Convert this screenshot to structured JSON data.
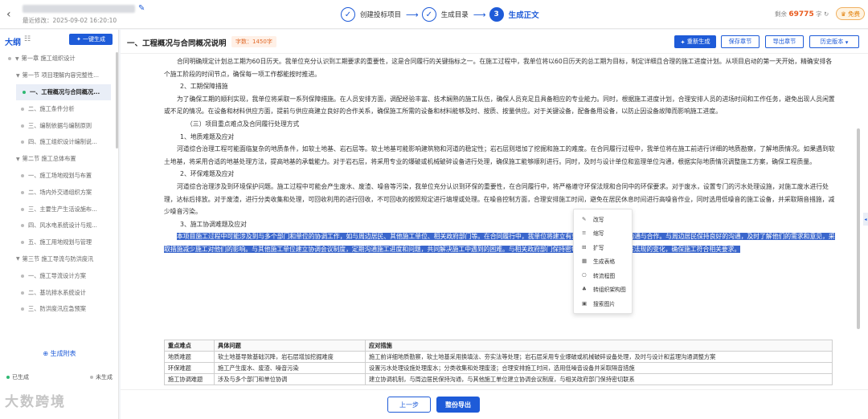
{
  "header": {
    "last_modified": "最近修改：2025-09-02 16:20:10",
    "steps": [
      {
        "icon": "✓",
        "label": "创建投标项目"
      },
      {
        "icon": "✓",
        "label": "生成目录"
      },
      {
        "icon": "3",
        "label": "生成正文"
      }
    ],
    "remain_label": "剩余",
    "remain_value": "69775",
    "remain_unit": "字",
    "vip_label": "免费"
  },
  "sidebar": {
    "title": "大纲",
    "generate_all": "一键生成",
    "items": [
      {
        "label": "第一章 施工组织设计"
      },
      {
        "label": "第一节 项目理解内容完整性..."
      },
      {
        "label": "一、工程概况与合同概况..."
      },
      {
        "label": "二、施工条件分析"
      },
      {
        "label": "三、编制依据与编制原则"
      },
      {
        "label": "四、施工组织设计编制说..."
      },
      {
        "label": "第二节 施工总体布置"
      },
      {
        "label": "一、施工场地规划与布置"
      },
      {
        "label": "二、场内外交通组织方案"
      },
      {
        "label": "三、主要生产生活设施布..."
      },
      {
        "label": "四、风水电系统设计与规..."
      },
      {
        "label": "五、施工用地规划与管理"
      },
      {
        "label": "第三节 施工导流与防洪度汛"
      },
      {
        "label": "一、施工导流设计方案"
      },
      {
        "label": "二、基坑排水系统设计"
      },
      {
        "label": "三、防洪度汛应急预案"
      }
    ],
    "attach": "生成附表",
    "legend_done": "已生成",
    "legend_todo": "未生成"
  },
  "main": {
    "section_title": "一、工程概况与合同概况说明",
    "word_count": "字数：1450字",
    "buttons": {
      "regen": "重新生成",
      "save": "保存章节",
      "export_section": "导出章节",
      "history": "历史版本"
    },
    "paragraphs": [
      "合同明确规定计划总工期为60日历天。我单位充分认识到工期要求的重要性，这是合同履行的关键指标之一。在施工过程中，我单位将以60日历天的总工期为目标，制定详细且合理的施工进度计划。从项目启动的第一天开始，精确安排各个施工阶段的时间节点，确保每一项工作都能按时推进。",
      "2、工期保障措施",
      "为了确保工期的顺利实现，我单位将采取一系列保障措施。在人员安排方面，调配经验丰富、技术娴熟的施工队伍，确保人员充足且具备相应的专业能力。同时，根据施工进度计划，合理安排人员的进场时间和工作任务，避免出现人员闲置或不足的情况。在设备和材料供应方面，提前与供应商建立良好的合作关系，确保施工所需的设备和材料能够及时、按质、按量供应。对于关键设备，配备备用设备，以防止因设备故障而影响施工进度。",
      "（三）项目重点难点及合同履行处理方式",
      "1、地质难题及应对",
      "河道综合治理工程可能面临复杂的地质条件，如软土地基、岩石层等。软土地基可能影响建筑物和河道的稳定性；岩石层则增加了挖掘和施工的难度。在合同履行过程中，我单位将在施工前进行详细的地质勘察，了解地质情况。如果遇到软土地基，将采用合适的地基处理方法，提高地基的承载能力。对于岩石层，将采用专业的爆破或机械破碎设备进行处理，确保施工能够顺利进行。同时，及时与设计单位和监理单位沟通，根据实际地质情况调整施工方案，确保工程质量。",
      "2、环保难题及应对",
      "河道综合治理涉及到环境保护问题。施工过程中可能会产生废水、废渣、噪音等污染，我单位充分认识到环保的重要性，在合同履行中，将严格遵守环保法规和合同中的环保要求。对于废水，设置专门的污水处理设施，对施工废水进行处理，达标后排放。对于废渣，进行分类收集和处理，可回收利用的进行回收，不可回收的按照规定进行填埋或处理。在噪音控制方面，合理安排施工时间，避免在居民休息时间进行高噪音作业，同时选用低噪音的施工设备，并采取隔音措施，减少噪音污染。",
      "3、施工协调难题及应对",
      "本项目施工过程中可能涉及到与多个部门和单位的协调工作，如与周边居民、其他施工单位、相关政府部门等。在合同履行中，我单位将建立有效的协调机制，加强沟通与合作。与周边居民保持良好的沟通，及时了解他们的需求和意见，采取措施减少施工对他们的影响。与其他施工单位建立协调会议制度，定期沟通施工进度和问题，共同解决施工中遇到的困难。与相关政府部门保持密切联系，及时了解政策法规的变化，确保施工符合相关要求。"
    ],
    "context_menu": [
      {
        "icon": "✎",
        "label": "改写"
      },
      {
        "icon": "≡",
        "label": "缩写"
      },
      {
        "icon": "⊞",
        "label": "扩写"
      },
      {
        "icon": "▦",
        "label": "生成表格"
      },
      {
        "icon": "⎔",
        "label": "转流程图"
      },
      {
        "icon": "♣",
        "label": "转组织架构图"
      },
      {
        "icon": "▣",
        "label": "搜索图片"
      }
    ],
    "table": {
      "headers": [
        "重点难点",
        "具体问题",
        "应对措施"
      ],
      "rows": [
        [
          "地质难题",
          "软土地基导致基础沉降，岩石层增加挖掘难度",
          "施工前详细地质勘察，软土地基采用换填法、夯实法等处理；岩石层采用专业爆破或机械破碎设备处理，及时与设计和监理沟通调整方案"
        ],
        [
          "环保难题",
          "施工产生废水、废渣、噪音污染",
          "设置污水处理设施处理废水；分类收集和处理废渣；合理安排施工时间，选用低噪音设备并采取隔音措施"
        ],
        [
          "施工协调难题",
          "涉及与多个部门和单位协调",
          "建立协调机制，与周边居民保持沟通，与其他施工单位建立协调会议制度，与相关政府部门保持密切联系"
        ]
      ]
    }
  },
  "footer": {
    "prev": "上一步",
    "export": "整份导出"
  },
  "watermark": "大数跨境"
}
